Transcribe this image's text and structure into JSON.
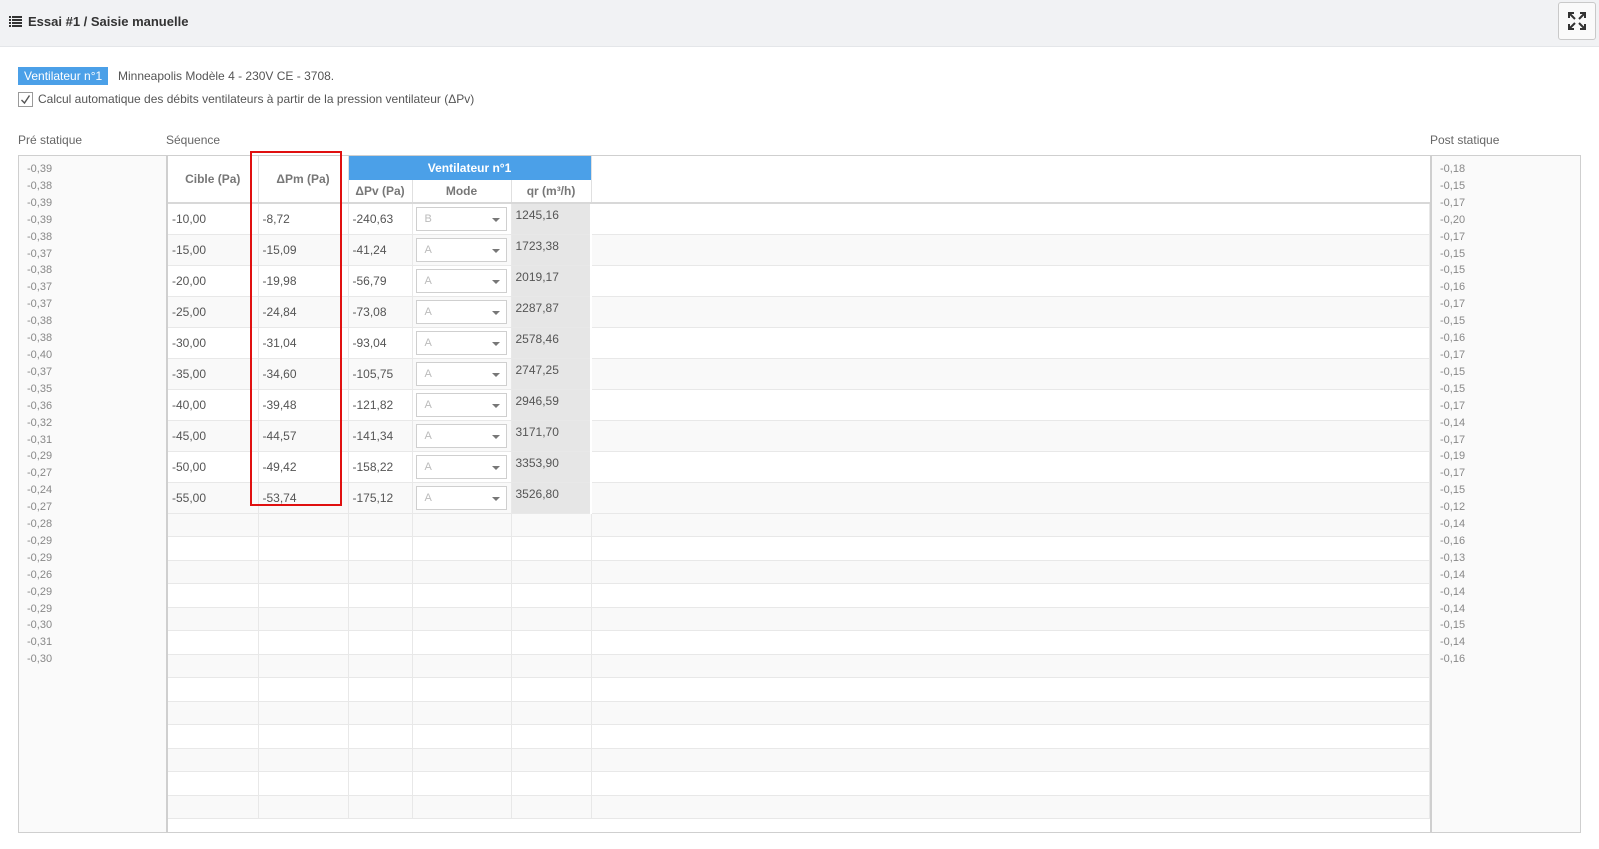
{
  "header": {
    "title": "Essai #1 / Saisie manuelle",
    "menu_icon": "list-icon",
    "expand_icon": "expand-icon"
  },
  "fan": {
    "badge": "Ventilateur n°1",
    "description": "Minneapolis Modèle 4 - 230V CE - 3708."
  },
  "auto_calc": {
    "checked": true,
    "label": "Calcul automatique des débits ventilateurs à partir de la pression ventilateur (ΔPv)"
  },
  "pre_static": {
    "label": "Pré statique",
    "values": [
      "-0,39",
      "-0,38",
      "-0,39",
      "-0,39",
      "-0,38",
      "-0,37",
      "-0,38",
      "-0,37",
      "-0,37",
      "-0,38",
      "-0,38",
      "-0,40",
      "-0,37",
      "-0,35",
      "-0,36",
      "-0,32",
      "-0,31",
      "-0,29",
      "-0,27",
      "-0,24",
      "-0,27",
      "-0,28",
      "-0,29",
      "-0,29",
      "-0,26",
      "-0,29",
      "-0,29",
      "-0,30",
      "-0,31",
      "-0,30"
    ]
  },
  "post_static": {
    "label": "Post statique",
    "values": [
      "-0,18",
      "-0,15",
      "-0,17",
      "-0,20",
      "-0,17",
      "-0,15",
      "-0,15",
      "-0,16",
      "-0,17",
      "-0,15",
      "-0,16",
      "-0,17",
      "-0,15",
      "-0,15",
      "-0,17",
      "-0,14",
      "-0,17",
      "-0,19",
      "-0,17",
      "-0,15",
      "-0,12",
      "-0,14",
      "-0,16",
      "-0,13",
      "-0,14",
      "-0,14",
      "-0,14",
      "-0,15",
      "-0,14",
      "-0,16"
    ]
  },
  "sequence": {
    "label": "Séquence",
    "columns": {
      "cible": "Cible (Pa)",
      "dpm": "ΔPm (Pa)",
      "fan_group": "Ventilateur n°1",
      "dpv": "ΔPv (Pa)",
      "mode": "Mode",
      "qr": "qr (m³/h)"
    },
    "rows": [
      {
        "cible": "-10,00",
        "dpm": "-8,72",
        "dpv": "-240,63",
        "mode": "B",
        "qr": "1245,16"
      },
      {
        "cible": "-15,00",
        "dpm": "-15,09",
        "dpv": "-41,24",
        "mode": "A",
        "qr": "1723,38"
      },
      {
        "cible": "-20,00",
        "dpm": "-19,98",
        "dpv": "-56,79",
        "mode": "A",
        "qr": "2019,17"
      },
      {
        "cible": "-25,00",
        "dpm": "-24,84",
        "dpv": "-73,08",
        "mode": "A",
        "qr": "2287,87"
      },
      {
        "cible": "-30,00",
        "dpm": "-31,04",
        "dpv": "-93,04",
        "mode": "A",
        "qr": "2578,46"
      },
      {
        "cible": "-35,00",
        "dpm": "-34,60",
        "dpv": "-105,75",
        "mode": "A",
        "qr": "2747,25"
      },
      {
        "cible": "-40,00",
        "dpm": "-39,48",
        "dpv": "-121,82",
        "mode": "A",
        "qr": "2946,59"
      },
      {
        "cible": "-45,00",
        "dpm": "-44,57",
        "dpv": "-141,34",
        "mode": "A",
        "qr": "3171,70"
      },
      {
        "cible": "-50,00",
        "dpm": "-49,42",
        "dpv": "-158,22",
        "mode": "A",
        "qr": "3353,90"
      },
      {
        "cible": "-55,00",
        "dpm": "-53,74",
        "dpv": "-175,12",
        "mode": "A",
        "qr": "3526,80"
      }
    ]
  },
  "colors": {
    "accent": "#4ba0e8",
    "highlight": "#e01010"
  }
}
